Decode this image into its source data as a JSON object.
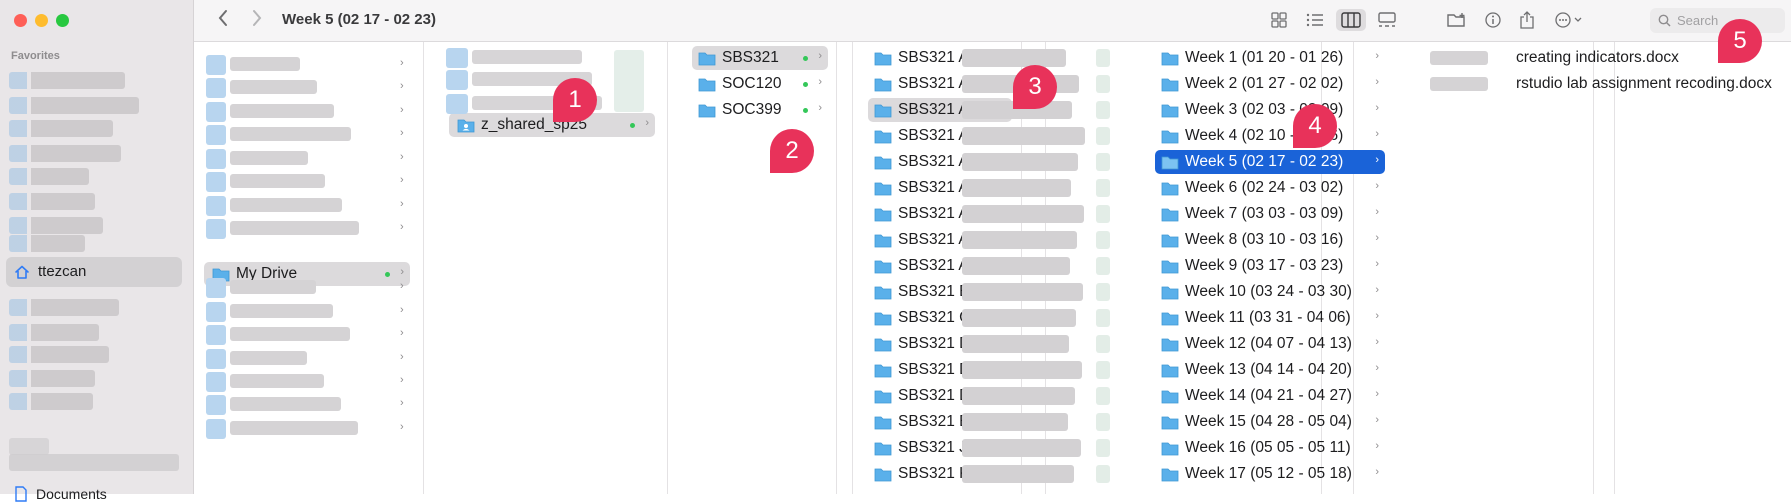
{
  "window": {
    "title": "Week 5 (02 17 - 02 23)"
  },
  "sidebar": {
    "heading": "Favorites",
    "selected_item": "ttezcan",
    "bottom_item": "Documents"
  },
  "toolbar": {
    "back_icon": "chevron-left",
    "forward_icon": "chevron-right",
    "view_icons": [
      "icon-view",
      "list-view",
      "column-view",
      "gallery-view"
    ],
    "active_view": "column-view",
    "action_icons": [
      "new-folder",
      "info",
      "share",
      "more"
    ],
    "search_placeholder": "Search"
  },
  "columns": {
    "col1": {
      "selected_label": "My Drive"
    },
    "col2": {
      "selected_label": "z_shared_sp25"
    },
    "col3": {
      "items": [
        "SBS321",
        "SOC120",
        "SOC399"
      ],
      "selected": "SBS321"
    },
    "col4": {
      "items": [
        "SBS321 A",
        "SBS321 A",
        "SBS321 A",
        "SBS321 A",
        "SBS321 A",
        "SBS321 A",
        "SBS321 A",
        "SBS321 A",
        "SBS321 A",
        "SBS321 E",
        "SBS321 C",
        "SBS321 D",
        "SBS321 D",
        "SBS321 D",
        "SBS321 E",
        "SBS321 J",
        "SBS321 K"
      ]
    },
    "col5": {
      "items": [
        "Week 1 (01 20 - 01 26)",
        "Week 2 (01 27 - 02 02)",
        "Week 3 (02 03 - 02 09)",
        "Week 4 (02 10 - 02 16)",
        "Week 5 (02 17 - 02 23)",
        "Week 6 (02 24 - 03 02)",
        "Week 7 (03 03 - 03 09)",
        "Week 8 (03 10 - 03 16)",
        "Week 9 (03 17 - 03 23)",
        "Week 10 (03 24 - 03 30)",
        "Week 11 (03 31 - 04 06)",
        "Week 12 (04 07 - 04 13)",
        "Week 13 (04 14 - 04 20)",
        "Week 14 (04 21 - 04 27)",
        "Week 15 (04 28 - 05 04)",
        "Week 16 (05 05 - 05 11)",
        "Week 17 (05 12 - 05 18)"
      ],
      "selected": "Week 5 (02 17 - 02 23)"
    },
    "col6": {
      "items": [
        "creating indicators.docx",
        "rstudio lab assignment recoding.docx"
      ]
    }
  },
  "badges": [
    "1",
    "2",
    "3",
    "4",
    "5"
  ],
  "colors": {
    "selection_blue": "#1a63d8",
    "badge": "#e8325a",
    "folder": "#5ab0ea"
  }
}
